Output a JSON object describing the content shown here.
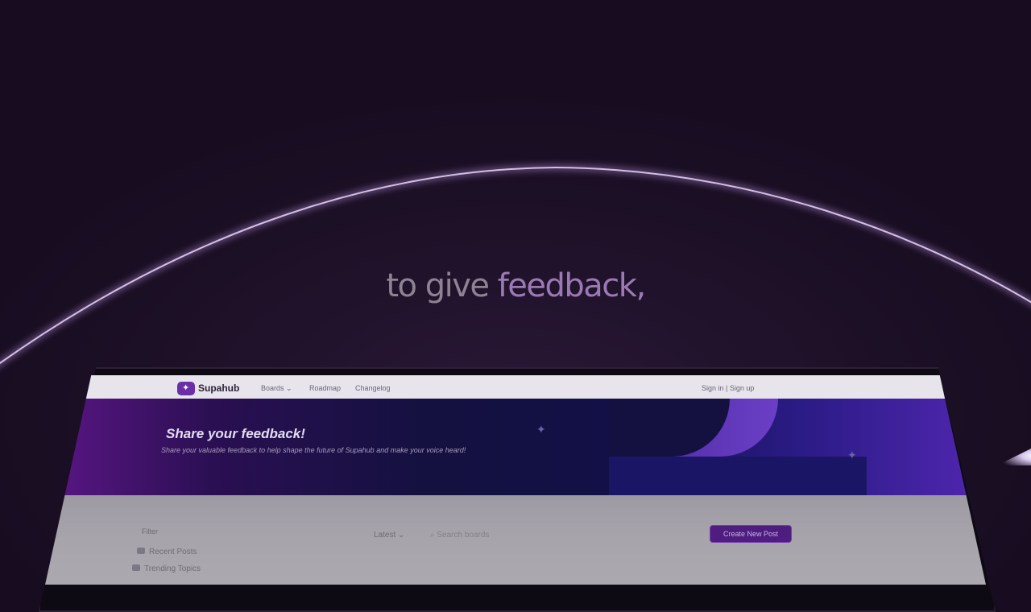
{
  "headline": {
    "lead": "to give ",
    "accent": "feedback,"
  },
  "app": {
    "brand": "Supahub",
    "nav": [
      "Boards ⌄",
      "Roadmap",
      "Changelog"
    ],
    "auth": "Sign in | Sign up",
    "hero": {
      "title": "Share your feedback!",
      "subtitle": "Share your valuable feedback to help shape the future of Supahub and make your voice heard!"
    },
    "filter_label": "Filter",
    "side_items": [
      "Recent Posts",
      "Trending Topics"
    ],
    "sort": "Latest ⌄",
    "search_placeholder": "Search boards",
    "create_button": "Create New Post"
  },
  "colors": {
    "accent": "#6a2fa8",
    "arc": "#c8a8e6",
    "background": "#160b1f"
  }
}
